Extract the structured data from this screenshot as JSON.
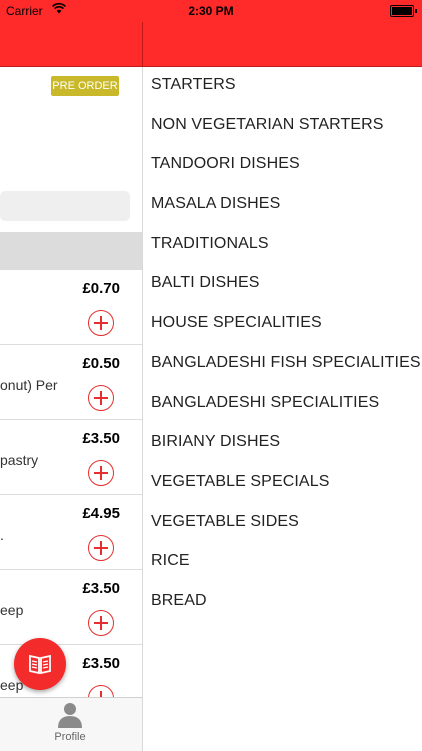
{
  "status_bar": {
    "carrier": "Carrier",
    "time": "2:30 PM"
  },
  "left": {
    "preorder_label": "PRE ORDER",
    "items": [
      {
        "price": "£0.70",
        "desc": ""
      },
      {
        "price": "£0.50",
        "desc": "onut) Per"
      },
      {
        "price": "£3.50",
        "desc": "pastry"
      },
      {
        "price": "£4.95",
        "desc": "."
      },
      {
        "price": "£3.50",
        "desc": "eep"
      },
      {
        "price": "£3.50",
        "desc": "eep"
      }
    ]
  },
  "tab_bar": {
    "profile_label": "Profile"
  },
  "menu": {
    "items": [
      "STARTERS",
      "NON VEGETARIAN STARTERS",
      "TANDOORI DISHES",
      "MASALA DISHES",
      "TRADITIONALS",
      "BALTI DISHES",
      "HOUSE SPECIALITIES",
      "BANGLADESHI FISH SPECIALITIES",
      "BANGLADESHI SPECIALITIES",
      "BIRIANY DISHES",
      "VEGETABLE SPECIALS",
      "VEGETABLE SIDES",
      "RICE",
      "BREAD"
    ]
  },
  "colors": {
    "brand_red": "#ff2a2a",
    "badge": "#c9b92a",
    "add_icon": "#e62e2e"
  },
  "icons": [
    "wifi-icon",
    "battery-icon",
    "plus-circle-icon",
    "menu-book-icon",
    "profile-icon"
  ]
}
